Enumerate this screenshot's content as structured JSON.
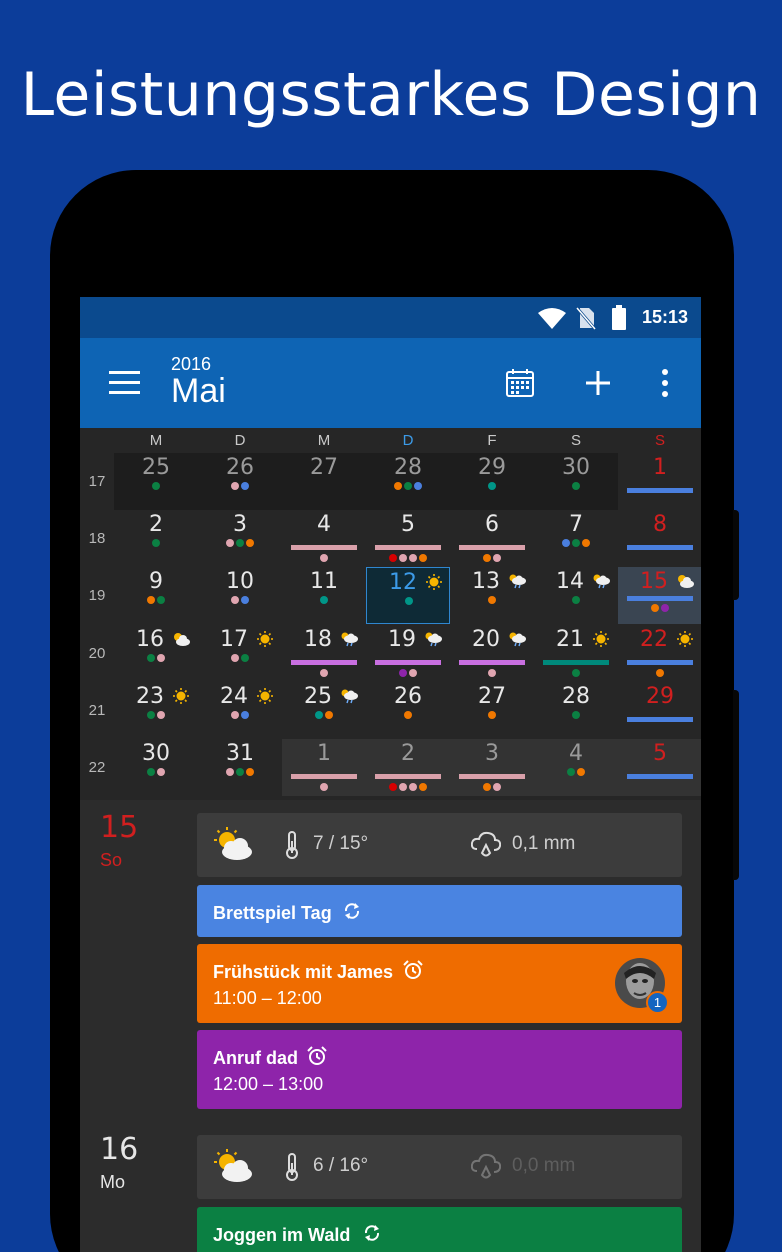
{
  "headline": "Leistungsstarkes Design",
  "status": {
    "time": "15:13"
  },
  "appbar": {
    "year": "2016",
    "month": "Mai"
  },
  "weekdays": [
    "M",
    "D",
    "M",
    "D",
    "F",
    "S",
    "S"
  ],
  "week_numbers": [
    "17",
    "18",
    "19",
    "20",
    "21",
    "22"
  ],
  "colors": {
    "blue": "#4a7fde",
    "orange": "#f07800",
    "purple": "#8e24aa",
    "green": "#0b8043",
    "red_sunday": "#d11f1f",
    "today_blue": "#3c9be8"
  },
  "weeks": [
    [
      {
        "d": "25",
        "dim": true,
        "shade": true,
        "dots": [
          "green"
        ]
      },
      {
        "d": "26",
        "dim": true,
        "shade": true,
        "dots": [
          "pink",
          "blue"
        ]
      },
      {
        "d": "27",
        "dim": true,
        "shade": true,
        "dots": []
      },
      {
        "d": "28",
        "dim": true,
        "shade": true,
        "dots": [
          "orange",
          "green",
          "blue"
        ]
      },
      {
        "d": "29",
        "dim": true,
        "shade": true,
        "dots": [
          "teal"
        ]
      },
      {
        "d": "30",
        "dim": true,
        "shade": true,
        "dots": [
          "green"
        ]
      },
      {
        "d": "1",
        "red": true,
        "bar": "blue",
        "dots": []
      }
    ],
    [
      {
        "d": "2",
        "dots": [
          "green"
        ]
      },
      {
        "d": "3",
        "dots": [
          "pink",
          "green",
          "orange"
        ]
      },
      {
        "d": "4",
        "bar": "pink",
        "dots": [
          "pink"
        ]
      },
      {
        "d": "5",
        "bar": "pink",
        "dots": [
          "red",
          "pink",
          "pink",
          "orange"
        ]
      },
      {
        "d": "6",
        "bar": "pink",
        "dots": [
          "orange",
          "pink"
        ]
      },
      {
        "d": "7",
        "dots": [
          "blue",
          "green",
          "orange"
        ]
      },
      {
        "d": "8",
        "red": true,
        "bar": "blue",
        "dots": []
      }
    ],
    [
      {
        "d": "9",
        "dots": [
          "orange",
          "green"
        ]
      },
      {
        "d": "10",
        "dots": [
          "pink",
          "blue"
        ]
      },
      {
        "d": "11",
        "dots": [
          "teal"
        ]
      },
      {
        "d": "12",
        "today": true,
        "wx": "sun",
        "dots": [
          "teal"
        ]
      },
      {
        "d": "13",
        "wx": "rain",
        "dots": [
          "orange"
        ]
      },
      {
        "d": "14",
        "wx": "rain",
        "dots": [
          "green"
        ]
      },
      {
        "d": "15",
        "red": true,
        "sel": true,
        "wx": "cloud",
        "bar": "blue",
        "dots": [
          "orange",
          "purple"
        ]
      }
    ],
    [
      {
        "d": "16",
        "wx": "cloud",
        "dots": [
          "green",
          "pink"
        ]
      },
      {
        "d": "17",
        "wx": "sun",
        "dots": [
          "pink",
          "green"
        ]
      },
      {
        "d": "18",
        "wx": "rain",
        "bar": "purple",
        "dots": [
          "pink"
        ]
      },
      {
        "d": "19",
        "wx": "rain",
        "bar": "purple",
        "dots": [
          "purple",
          "pink"
        ]
      },
      {
        "d": "20",
        "wx": "rain",
        "bar": "purple",
        "dots": [
          "pink"
        ]
      },
      {
        "d": "21",
        "wx": "sun",
        "bar": "teal",
        "dots": [
          "green"
        ]
      },
      {
        "d": "22",
        "red": true,
        "wx": "sun",
        "bar": "blue",
        "dots": [
          "orange"
        ]
      }
    ],
    [
      {
        "d": "23",
        "wx": "sun",
        "dots": [
          "green",
          "pink"
        ]
      },
      {
        "d": "24",
        "wx": "sun",
        "dots": [
          "pink",
          "blue"
        ]
      },
      {
        "d": "25",
        "wx": "rain",
        "dots": [
          "teal",
          "orange"
        ]
      },
      {
        "d": "26",
        "dots": [
          "orange"
        ]
      },
      {
        "d": "27",
        "dots": [
          "orange"
        ]
      },
      {
        "d": "28",
        "dots": [
          "green"
        ]
      },
      {
        "d": "29",
        "red": true,
        "bar": "blue",
        "dots": []
      }
    ],
    [
      {
        "d": "30",
        "dots": [
          "green",
          "pink"
        ]
      },
      {
        "d": "31",
        "dots": [
          "pink",
          "green",
          "orange"
        ]
      },
      {
        "d": "1",
        "dim": true,
        "light": true,
        "bar": "pink",
        "dots": [
          "pink"
        ]
      },
      {
        "d": "2",
        "dim": true,
        "light": true,
        "bar": "pink",
        "dots": [
          "red",
          "pink",
          "pink",
          "orange"
        ]
      },
      {
        "d": "3",
        "dim": true,
        "light": true,
        "bar": "pink",
        "dots": [
          "orange",
          "pink"
        ]
      },
      {
        "d": "4",
        "dim": true,
        "light": true,
        "dots": [
          "green",
          "orange"
        ]
      },
      {
        "d": "5",
        "red": true,
        "light": true,
        "bar": "blue",
        "dots": []
      }
    ]
  ],
  "agenda": [
    {
      "day": "15",
      "dow": "So",
      "red": true,
      "weather": {
        "temp": "7 / 15°",
        "rain": "0,1 mm"
      },
      "events": [
        {
          "title": "Brettspiel Tag",
          "time": "",
          "color": "#4a84e1",
          "icon": "repeat"
        },
        {
          "title": "Frühstück mit James",
          "time": "11:00 – 12:00",
          "color": "#ef6c00",
          "icon": "alarm",
          "badge": "1"
        },
        {
          "title": "Anruf dad",
          "time": "12:00 – 13:00",
          "color": "#8e24aa",
          "icon": "alarm"
        }
      ]
    },
    {
      "day": "16",
      "dow": "Mo",
      "red": false,
      "weather": {
        "temp": "6 / 16°",
        "rain": "0,0 mm"
      },
      "events": [
        {
          "title": "Joggen im Wald",
          "time": "",
          "color": "#0b8043",
          "icon": "repeat"
        }
      ]
    }
  ]
}
